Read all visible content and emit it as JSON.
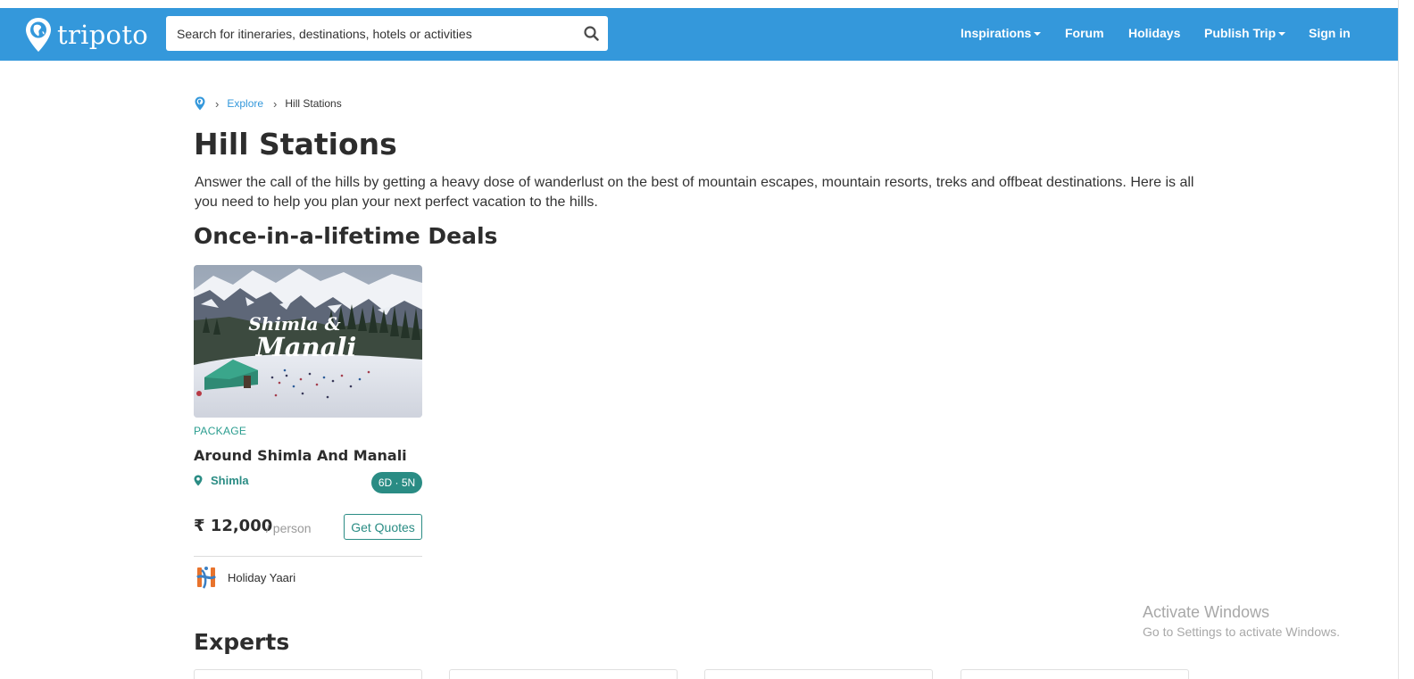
{
  "brand": {
    "name": "tripoto",
    "color": "#3498db",
    "accent": "#2a8c84"
  },
  "search": {
    "placeholder": "Search for itineraries, destinations, hotels or activities",
    "icon": "search-icon"
  },
  "nav": {
    "items": [
      {
        "label": "Inspirations",
        "dropdown": true
      },
      {
        "label": "Forum",
        "dropdown": false
      },
      {
        "label": "Holidays",
        "dropdown": false
      },
      {
        "label": "Publish Trip",
        "dropdown": true
      },
      {
        "label": "Sign in",
        "dropdown": false
      }
    ]
  },
  "breadcrumb": {
    "home_icon": "location-pin-icon",
    "explore": "Explore",
    "current": "Hill Stations"
  },
  "page": {
    "title": "Hill Stations",
    "description": "Answer the call of the hills by getting a heavy dose of wanderlust on the best of mountain escapes, mountain resorts, treks and offbeat destinations. Here is all you need to help you plan your next perfect vacation to the hills."
  },
  "deals": {
    "heading": "Once-in-a-lifetime Deals",
    "cards": [
      {
        "image_text_line1": "Shimla &",
        "image_text_line2": "Manali",
        "type": "PACKAGE",
        "title": "Around Shimla And Manali",
        "location": "Shimla",
        "duration": "6D · 5N",
        "price": "₹ 12,000",
        "price_unit": "/ person",
        "cta": "Get Quotes",
        "seller": "Holiday Yaari"
      }
    ]
  },
  "experts": {
    "heading": "Experts"
  },
  "windows_watermark": {
    "title": "Activate Windows",
    "subtitle": "Go to Settings to activate Windows."
  }
}
